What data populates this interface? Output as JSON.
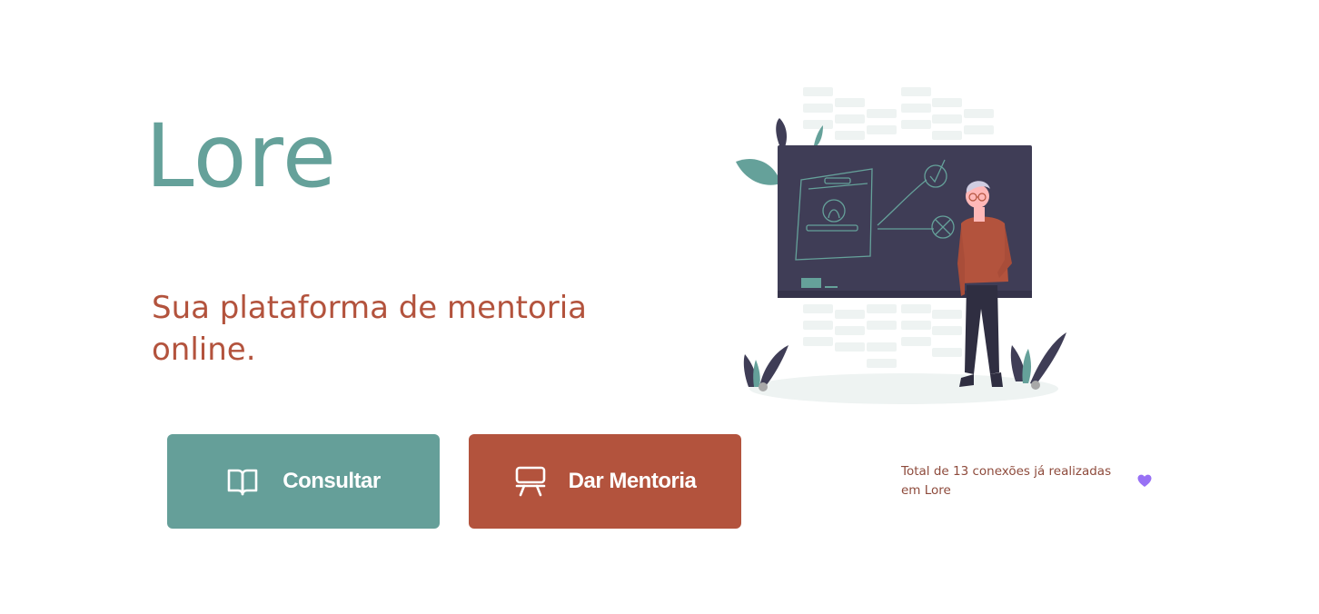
{
  "brand": {
    "name": "Lore"
  },
  "hero": {
    "tagline": "Sua plataforma de mentoria online."
  },
  "actions": {
    "consult_label": "Consultar",
    "consult_icon": "book-open-icon",
    "mentor_label": "Dar Mentoria",
    "mentor_icon": "presentation-board-icon"
  },
  "footer": {
    "connections_text": "Total de 13 conexões já realizadas em Lore",
    "heart_icon": "heart-icon"
  },
  "colors": {
    "teal": "#659f99",
    "terracotta": "#b3533d",
    "board": "#3f3d56",
    "heart": "#9871f5"
  }
}
